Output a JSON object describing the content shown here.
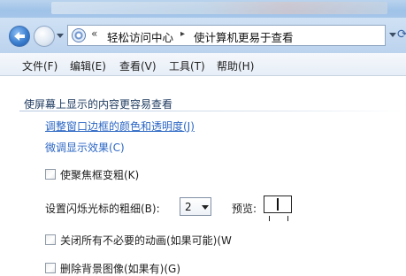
{
  "address_bar": {
    "overflow_chevron": "«",
    "crumbs": [
      "轻松访问中心",
      "使计算机更易于查看"
    ],
    "separator": "▸"
  },
  "menu": [
    "文件(F)",
    "编辑(E)",
    "查看(V)",
    "工具(T)",
    "帮助(H)"
  ],
  "section": {
    "heading": "使屏幕上显示的内容更容易查看",
    "links": [
      "调整窗口边框的颜色和透明度(J)",
      "微调显示效果(C)"
    ],
    "focus_checkbox": {
      "label": "使聚焦框变粗(K)",
      "checked": false
    },
    "cursor_width": {
      "label": "设置闪烁光标的粗细(B):",
      "value": "2",
      "preview_label": "预览:"
    },
    "animations_checkbox": {
      "label": "关闭所有不必要的动画(如果可能)(W",
      "checked": false
    },
    "background_checkbox": {
      "label": "删除背景图像(如果有)(G)",
      "checked": false
    }
  }
}
